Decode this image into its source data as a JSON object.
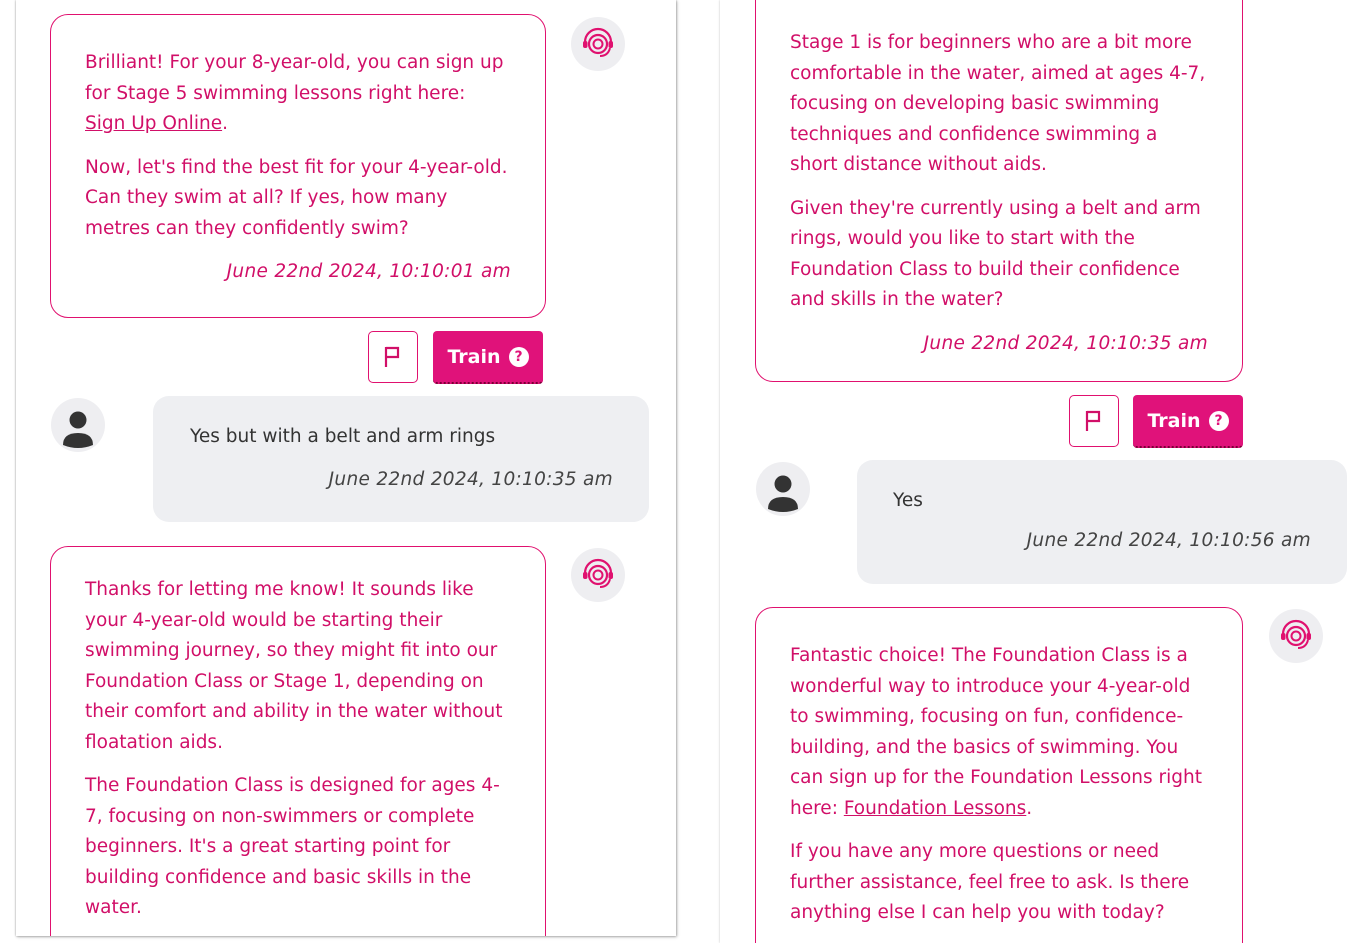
{
  "left_panel": {
    "bot_message_1": {
      "paragraph_1_before_link": "Brilliant! For your 8-year-old, you can sign up for Stage 5 swimming lessons right here: ",
      "paragraph_1_link": "Sign Up Online",
      "paragraph_1_after_link": ".",
      "paragraph_2": "Now, let's find the best fit for your 4-year-old. Can they swim at all? If yes, how many metres can they confidently swim?",
      "timestamp": "June 22nd 2024, 10:10:01 am"
    },
    "actions": {
      "flag_label": "P",
      "train_label": "Train",
      "help_symbol": "?"
    },
    "user_message": {
      "text": "Yes but with a belt and arm rings",
      "timestamp": "June 22nd 2024, 10:10:35 am"
    },
    "bot_message_2": {
      "paragraph_1": "Thanks for letting me know! It sounds like your 4-year-old would be starting their swimming journey, so they might fit into our Foundation Class or Stage 1, depending on their comfort and ability in the water without floatation aids.",
      "paragraph_2": "The Foundation Class is designed for ages 4-7, focusing on non-swimmers or complete beginners. It's a great starting point for building confidence and basic skills in the water."
    }
  },
  "right_panel": {
    "bot_message_1": {
      "paragraph_1": "Stage 1 is for beginners who are a bit more comfortable in the water, aimed at ages 4-7, focusing on developing basic swimming techniques and confidence swimming a short distance without aids.",
      "paragraph_2": "Given they're currently using a belt and arm rings, would you like to start with the Foundation Class to build their confidence and skills in the water?",
      "timestamp": "June 22nd 2024, 10:10:35 am"
    },
    "actions": {
      "flag_label": "P",
      "train_label": "Train",
      "help_symbol": "?"
    },
    "user_message": {
      "text": "Yes",
      "timestamp": "June 22nd 2024, 10:10:56 am"
    },
    "bot_message_2": {
      "paragraph_1_before_link": "Fantastic choice! The Foundation Class is a wonderful way to introduce your 4-year-old to swimming, focusing on fun, confidence-building, and the basics of swimming. You can sign up for the Foundation Lessons right here: ",
      "paragraph_1_link": "Foundation Lessons",
      "paragraph_1_after_link": ".",
      "paragraph_2": "If you have any more questions or need further assistance, feel free to ask. Is there anything else I can help you with today?"
    }
  },
  "colors": {
    "accent": "#e0116f",
    "bot_text": "#d10f68",
    "user_bubble_bg": "#eeeff2",
    "icon_bg": "#eeeef1"
  },
  "icons": {
    "bot": "headset-agent-icon",
    "user": "person-avatar-icon",
    "flag": "flag-icon",
    "help": "question-circle-icon"
  }
}
